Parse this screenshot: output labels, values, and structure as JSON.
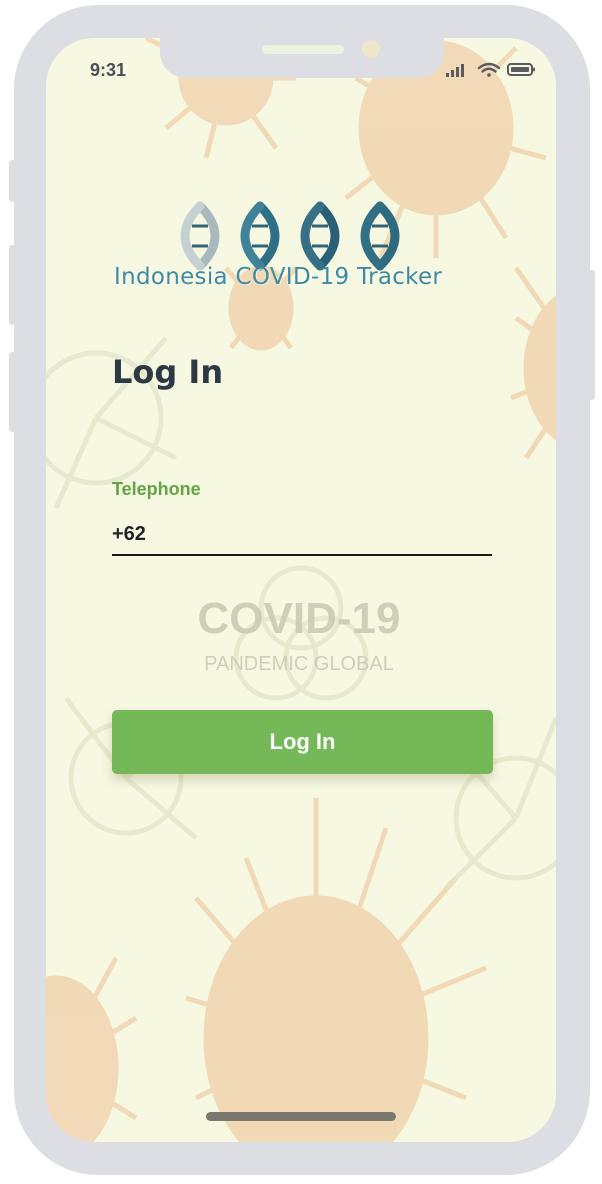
{
  "status_bar": {
    "time": "9:31",
    "icons": [
      "cellular-signal-icon",
      "wifi-icon",
      "battery-icon"
    ]
  },
  "brand": {
    "logo_icon": "dna-helix-icon",
    "name": "Indonesia COVID-19 Tracker"
  },
  "background": {
    "motif": "virus-pattern",
    "watermark_title": "COVID-19",
    "watermark_subtitle": "PANDEMIC GLOBAL"
  },
  "login": {
    "heading": "Log In",
    "telephone_label": "Telephone",
    "telephone_value": "+62",
    "submit_label": "Log In"
  },
  "colors": {
    "accent_green": "#74b858",
    "label_green": "#62a442",
    "brand_teal": "#3e8aa0",
    "screen_bg": "#f6f8e2"
  }
}
